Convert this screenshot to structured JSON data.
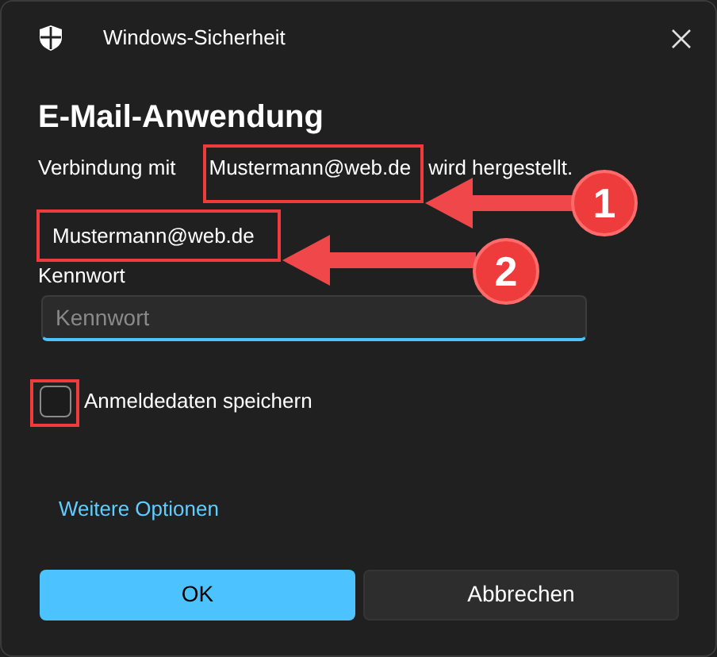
{
  "window": {
    "title": "Windows-Sicherheit"
  },
  "heading": "E-Mail-Anwendung",
  "connection": {
    "prefix": "Verbindung mit",
    "email": "Mustermann@web.de",
    "suffix": "wird hergestellt."
  },
  "account": "Mustermann@web.de",
  "password": {
    "label": "Kennwort",
    "placeholder": "Kennwort"
  },
  "remember": {
    "label": "Anmeldedaten speichern",
    "checked": false
  },
  "more_link": "Weitere Optionen",
  "buttons": [
    {
      "label": "OK",
      "kind": "primary"
    },
    {
      "label": "Abbrechen",
      "kind": "secondary"
    }
  ],
  "annotations": [
    {
      "label": "1"
    },
    {
      "label": "2"
    }
  ]
}
